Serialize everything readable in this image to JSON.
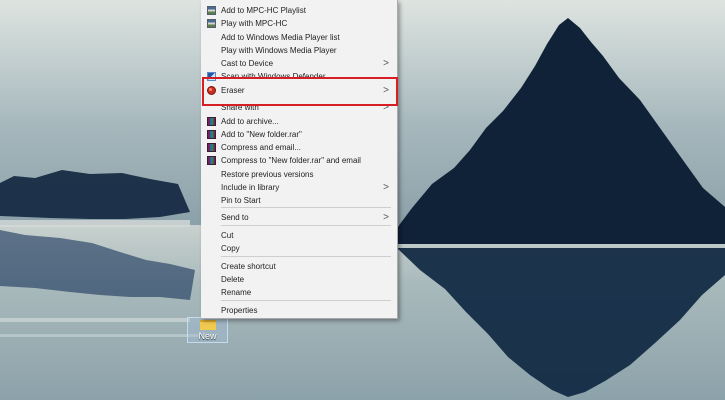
{
  "desktop": {
    "icon_label": "New folder"
  },
  "context_menu": {
    "items": [
      {
        "label": "Add to MPC-HC Playlist",
        "icon": "mpc-hc-icon",
        "has_submenu": false
      },
      {
        "label": "Play with MPC-HC",
        "icon": "mpc-hc-icon",
        "has_submenu": false
      },
      {
        "label": "Add to Windows Media Player list",
        "icon": "",
        "has_submenu": false
      },
      {
        "label": "Play with Windows Media Player",
        "icon": "",
        "has_submenu": false
      },
      {
        "label": "Cast to Device",
        "icon": "",
        "has_submenu": true
      },
      {
        "label": "Scan with Windows Defender...",
        "icon": "windows-defender-icon",
        "has_submenu": false
      },
      {
        "label": "Eraser",
        "icon": "eraser-icon",
        "has_submenu": true
      },
      {
        "label": "Share with",
        "icon": "",
        "has_submenu": true
      },
      {
        "label": "Add to archive...",
        "icon": "winrar-icon",
        "has_submenu": false
      },
      {
        "label": "Add to \"New folder.rar\"",
        "icon": "winrar-icon",
        "has_submenu": false
      },
      {
        "label": "Compress and email...",
        "icon": "winrar-icon",
        "has_submenu": false
      },
      {
        "label": "Compress to \"New folder.rar\" and email",
        "icon": "winrar-icon",
        "has_submenu": false
      },
      {
        "label": "Restore previous versions",
        "icon": "",
        "has_submenu": false
      },
      {
        "label": "Include in library",
        "icon": "",
        "has_submenu": true
      },
      {
        "label": "Pin to Start",
        "icon": "",
        "has_submenu": false
      },
      {
        "label": "Send to",
        "icon": "",
        "has_submenu": true
      },
      {
        "label": "Cut",
        "icon": "",
        "has_submenu": false
      },
      {
        "label": "Copy",
        "icon": "",
        "has_submenu": false
      },
      {
        "label": "Create shortcut",
        "icon": "",
        "has_submenu": false
      },
      {
        "label": "Delete",
        "icon": "",
        "has_submenu": false
      },
      {
        "label": "Rename",
        "icon": "",
        "has_submenu": false
      },
      {
        "label": "Properties",
        "icon": "",
        "has_submenu": false
      }
    ],
    "submenu_arrow_glyph": ">"
  },
  "colors": {
    "highlight": "#d51f24",
    "menu_background": "#f2f2f2"
  }
}
